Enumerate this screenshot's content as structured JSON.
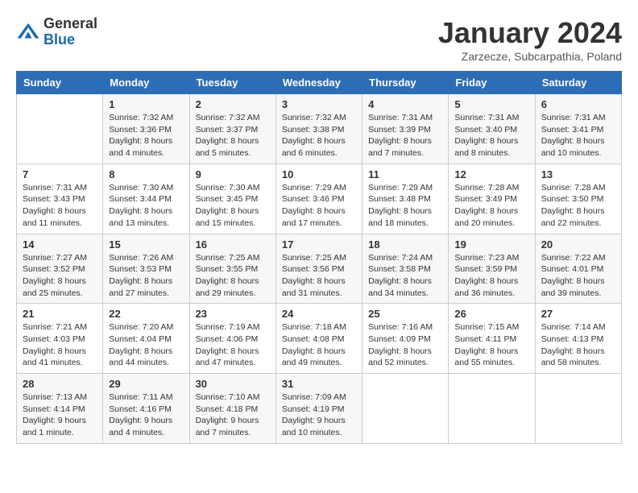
{
  "logo": {
    "general": "General",
    "blue": "Blue"
  },
  "title": "January 2024",
  "subtitle": "Zarzecze, Subcarpathia, Poland",
  "days_of_week": [
    "Sunday",
    "Monday",
    "Tuesday",
    "Wednesday",
    "Thursday",
    "Friday",
    "Saturday"
  ],
  "weeks": [
    [
      {
        "day": "",
        "sunrise": "",
        "sunset": "",
        "daylight": ""
      },
      {
        "day": "1",
        "sunrise": "Sunrise: 7:32 AM",
        "sunset": "Sunset: 3:36 PM",
        "daylight": "Daylight: 8 hours and 4 minutes."
      },
      {
        "day": "2",
        "sunrise": "Sunrise: 7:32 AM",
        "sunset": "Sunset: 3:37 PM",
        "daylight": "Daylight: 8 hours and 5 minutes."
      },
      {
        "day": "3",
        "sunrise": "Sunrise: 7:32 AM",
        "sunset": "Sunset: 3:38 PM",
        "daylight": "Daylight: 8 hours and 6 minutes."
      },
      {
        "day": "4",
        "sunrise": "Sunrise: 7:31 AM",
        "sunset": "Sunset: 3:39 PM",
        "daylight": "Daylight: 8 hours and 7 minutes."
      },
      {
        "day": "5",
        "sunrise": "Sunrise: 7:31 AM",
        "sunset": "Sunset: 3:40 PM",
        "daylight": "Daylight: 8 hours and 8 minutes."
      },
      {
        "day": "6",
        "sunrise": "Sunrise: 7:31 AM",
        "sunset": "Sunset: 3:41 PM",
        "daylight": "Daylight: 8 hours and 10 minutes."
      }
    ],
    [
      {
        "day": "7",
        "sunrise": "Sunrise: 7:31 AM",
        "sunset": "Sunset: 3:43 PM",
        "daylight": "Daylight: 8 hours and 11 minutes."
      },
      {
        "day": "8",
        "sunrise": "Sunrise: 7:30 AM",
        "sunset": "Sunset: 3:44 PM",
        "daylight": "Daylight: 8 hours and 13 minutes."
      },
      {
        "day": "9",
        "sunrise": "Sunrise: 7:30 AM",
        "sunset": "Sunset: 3:45 PM",
        "daylight": "Daylight: 8 hours and 15 minutes."
      },
      {
        "day": "10",
        "sunrise": "Sunrise: 7:29 AM",
        "sunset": "Sunset: 3:46 PM",
        "daylight": "Daylight: 8 hours and 17 minutes."
      },
      {
        "day": "11",
        "sunrise": "Sunrise: 7:29 AM",
        "sunset": "Sunset: 3:48 PM",
        "daylight": "Daylight: 8 hours and 18 minutes."
      },
      {
        "day": "12",
        "sunrise": "Sunrise: 7:28 AM",
        "sunset": "Sunset: 3:49 PM",
        "daylight": "Daylight: 8 hours and 20 minutes."
      },
      {
        "day": "13",
        "sunrise": "Sunrise: 7:28 AM",
        "sunset": "Sunset: 3:50 PM",
        "daylight": "Daylight: 8 hours and 22 minutes."
      }
    ],
    [
      {
        "day": "14",
        "sunrise": "Sunrise: 7:27 AM",
        "sunset": "Sunset: 3:52 PM",
        "daylight": "Daylight: 8 hours and 25 minutes."
      },
      {
        "day": "15",
        "sunrise": "Sunrise: 7:26 AM",
        "sunset": "Sunset: 3:53 PM",
        "daylight": "Daylight: 8 hours and 27 minutes."
      },
      {
        "day": "16",
        "sunrise": "Sunrise: 7:25 AM",
        "sunset": "Sunset: 3:55 PM",
        "daylight": "Daylight: 8 hours and 29 minutes."
      },
      {
        "day": "17",
        "sunrise": "Sunrise: 7:25 AM",
        "sunset": "Sunset: 3:56 PM",
        "daylight": "Daylight: 8 hours and 31 minutes."
      },
      {
        "day": "18",
        "sunrise": "Sunrise: 7:24 AM",
        "sunset": "Sunset: 3:58 PM",
        "daylight": "Daylight: 8 hours and 34 minutes."
      },
      {
        "day": "19",
        "sunrise": "Sunrise: 7:23 AM",
        "sunset": "Sunset: 3:59 PM",
        "daylight": "Daylight: 8 hours and 36 minutes."
      },
      {
        "day": "20",
        "sunrise": "Sunrise: 7:22 AM",
        "sunset": "Sunset: 4:01 PM",
        "daylight": "Daylight: 8 hours and 39 minutes."
      }
    ],
    [
      {
        "day": "21",
        "sunrise": "Sunrise: 7:21 AM",
        "sunset": "Sunset: 4:03 PM",
        "daylight": "Daylight: 8 hours and 41 minutes."
      },
      {
        "day": "22",
        "sunrise": "Sunrise: 7:20 AM",
        "sunset": "Sunset: 4:04 PM",
        "daylight": "Daylight: 8 hours and 44 minutes."
      },
      {
        "day": "23",
        "sunrise": "Sunrise: 7:19 AM",
        "sunset": "Sunset: 4:06 PM",
        "daylight": "Daylight: 8 hours and 47 minutes."
      },
      {
        "day": "24",
        "sunrise": "Sunrise: 7:18 AM",
        "sunset": "Sunset: 4:08 PM",
        "daylight": "Daylight: 8 hours and 49 minutes."
      },
      {
        "day": "25",
        "sunrise": "Sunrise: 7:16 AM",
        "sunset": "Sunset: 4:09 PM",
        "daylight": "Daylight: 8 hours and 52 minutes."
      },
      {
        "day": "26",
        "sunrise": "Sunrise: 7:15 AM",
        "sunset": "Sunset: 4:11 PM",
        "daylight": "Daylight: 8 hours and 55 minutes."
      },
      {
        "day": "27",
        "sunrise": "Sunrise: 7:14 AM",
        "sunset": "Sunset: 4:13 PM",
        "daylight": "Daylight: 8 hours and 58 minutes."
      }
    ],
    [
      {
        "day": "28",
        "sunrise": "Sunrise: 7:13 AM",
        "sunset": "Sunset: 4:14 PM",
        "daylight": "Daylight: 9 hours and 1 minute."
      },
      {
        "day": "29",
        "sunrise": "Sunrise: 7:11 AM",
        "sunset": "Sunset: 4:16 PM",
        "daylight": "Daylight: 9 hours and 4 minutes."
      },
      {
        "day": "30",
        "sunrise": "Sunrise: 7:10 AM",
        "sunset": "Sunset: 4:18 PM",
        "daylight": "Daylight: 9 hours and 7 minutes."
      },
      {
        "day": "31",
        "sunrise": "Sunrise: 7:09 AM",
        "sunset": "Sunset: 4:19 PM",
        "daylight": "Daylight: 9 hours and 10 minutes."
      },
      {
        "day": "",
        "sunrise": "",
        "sunset": "",
        "daylight": ""
      },
      {
        "day": "",
        "sunrise": "",
        "sunset": "",
        "daylight": ""
      },
      {
        "day": "",
        "sunrise": "",
        "sunset": "",
        "daylight": ""
      }
    ]
  ]
}
